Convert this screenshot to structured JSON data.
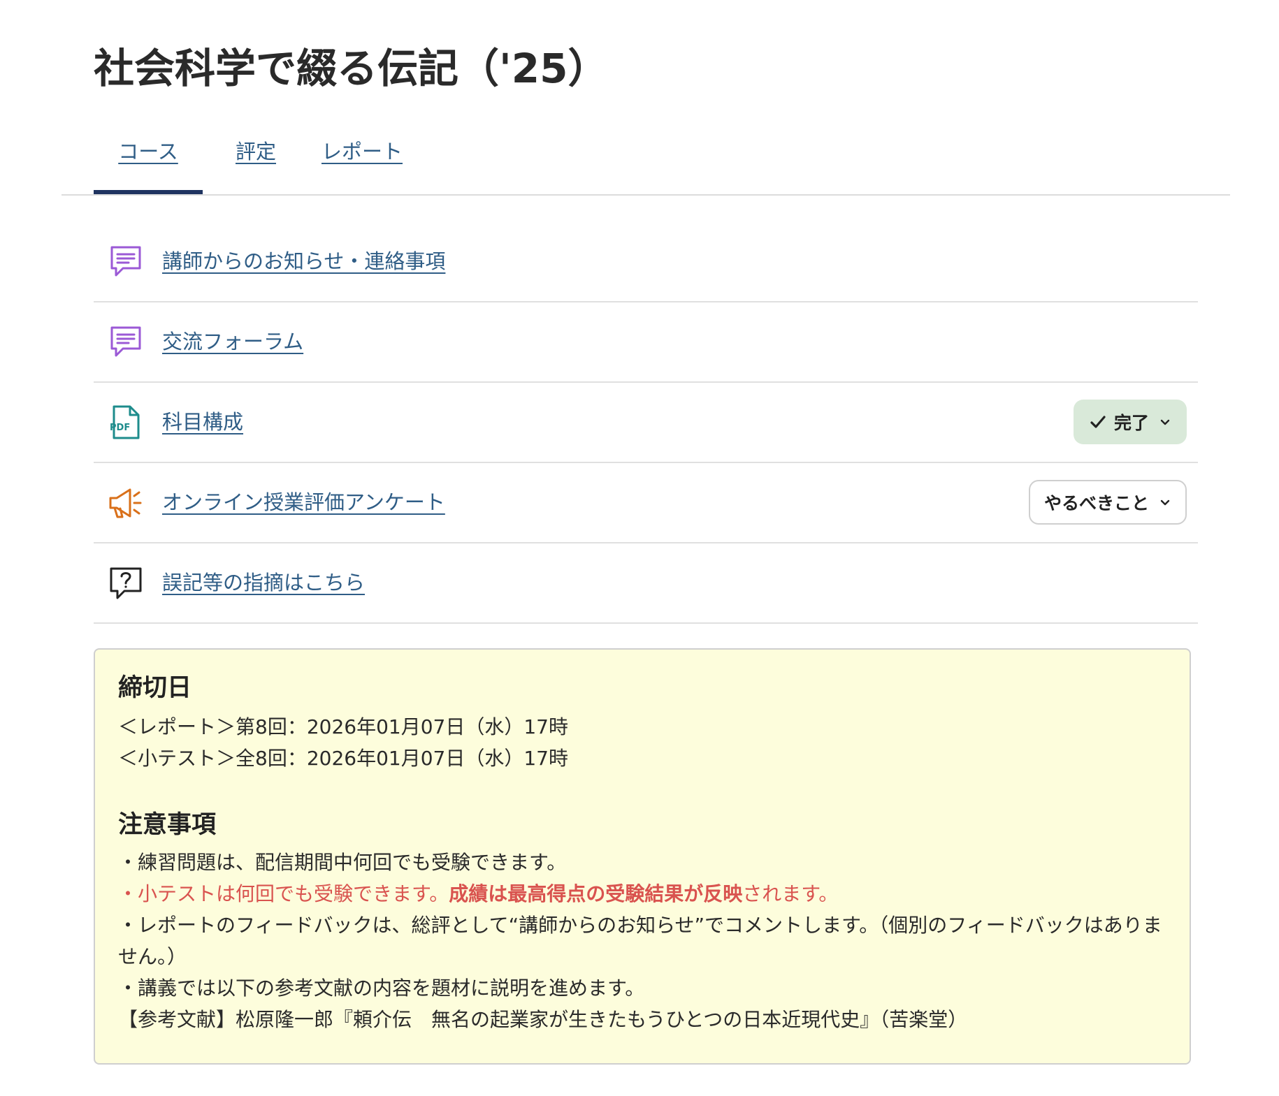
{
  "course_title": "社会科学で綴る伝記（'25）",
  "tabs": [
    {
      "label": "コース",
      "active": true
    },
    {
      "label": "評定",
      "active": false
    },
    {
      "label": "レポート",
      "active": false
    }
  ],
  "modules": [
    {
      "icon": "discussion-icon",
      "label": "講師からのお知らせ・連絡事項"
    },
    {
      "icon": "discussion-icon",
      "label": "交流フォーラム"
    },
    {
      "icon": "pdf-file-icon",
      "label": "科目構成",
      "status": "完了"
    },
    {
      "icon": "megaphone-icon",
      "label": "オンライン授業評価アンケート",
      "status": "やるべきこと"
    },
    {
      "icon": "question-bubble-icon",
      "label": "誤記等の指摘はこちら"
    }
  ],
  "info": {
    "deadline_heading": "締切日",
    "deadline_lines": [
      "＜レポート＞第8回：2026年01月07日（水）17時",
      "＜小テスト＞全8回：2026年01月07日（水）17時"
    ],
    "notes_heading": "注意事項",
    "note1": "・練習問題は、配信期間中何回でも受験できます。",
    "note2_part1": "・小テストは何回でも受験できます。",
    "note2_bold": "成績は最高得点の受験結果が反映",
    "note2_part2": "されます。",
    "note3": "・レポートのフィードバックは、総評として“講師からのお知らせ”でコメントします。（個別のフィードバックはありません。）",
    "note4": "・講義では以下の参考文献の内容を題材に説明を進めます。",
    "note5": "【参考文献】松原隆一郎『頼介伝　無名の起業家が生きたもうひとつの日本近現代史』（苦楽堂）"
  },
  "colors": {
    "link": "#2f5d86",
    "active_tab_bar": "#1f3360",
    "discussion_icon": "#9b59d6",
    "pdf_icon": "#1e8c8c",
    "megaphone_icon": "#d9701a",
    "done_pill_bg": "#d9e9d9",
    "info_bg": "#fdfddc",
    "warning_text": "#d9534f"
  }
}
